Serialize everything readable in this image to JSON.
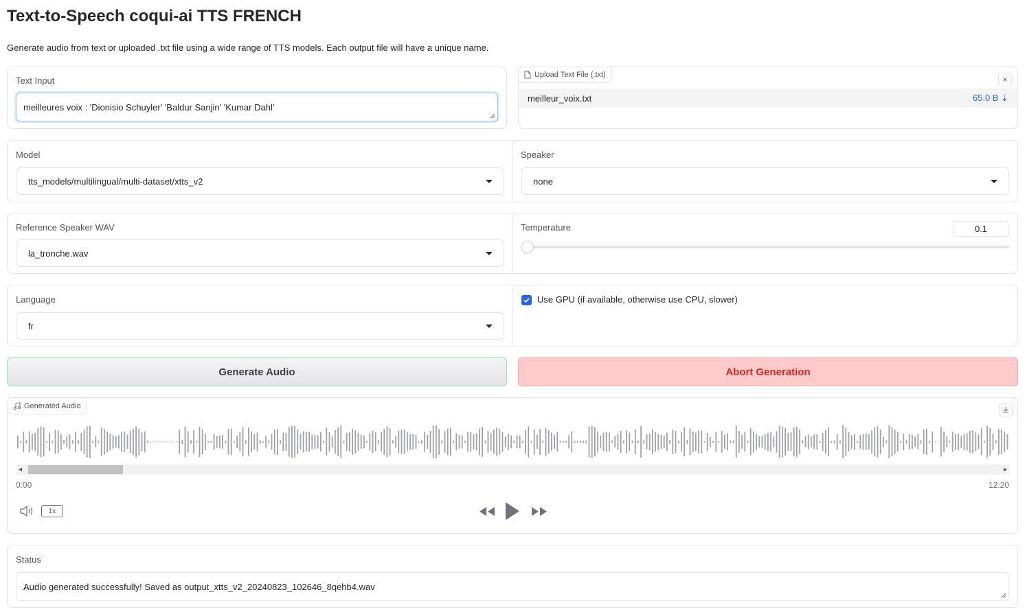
{
  "header": {
    "title": "Text-to-Speech coqui-ai TTS FRENCH",
    "subtitle": "Generate audio from text or uploaded .txt file using a wide range of TTS models. Each output file will have a unique name."
  },
  "text_input": {
    "label": "Text Input",
    "value": "meilleures voix : 'Dionisio Schuyler'  'Baldur Sanjin' 'Kumar Dahl'"
  },
  "upload": {
    "label": "Upload Text File (.txt)",
    "file_name": "meilleur_voix.txt",
    "file_size": "65.0 B",
    "download_glyph": "⇣",
    "close_glyph": "×"
  },
  "model": {
    "label": "Model",
    "selected": "tts_models/multilingual/multi-dataset/xtts_v2"
  },
  "speaker": {
    "label": "Speaker",
    "selected": "none"
  },
  "reference_wav": {
    "label": "Reference Speaker WAV",
    "selected": "la_tronche.wav"
  },
  "temperature": {
    "label": "Temperature",
    "value": "0.1",
    "level": 0.0
  },
  "language": {
    "label": "Language",
    "selected": "fr"
  },
  "gpu": {
    "label": "Use GPU (if available, otherwise use CPU, slower)",
    "checked": true
  },
  "actions": {
    "generate_label": "Generate Audio",
    "abort_label": "Abort Generation"
  },
  "audio": {
    "label": "Generated Audio",
    "current_time": "0:00",
    "duration": "12:20",
    "speed": "1x",
    "scroll_left": "◂",
    "scroll_right": "▸"
  },
  "status": {
    "label": "Status",
    "value": "Audio generated successfully! Saved as output_xtts_v2_20240823_102646_8qehb4.wav"
  },
  "colors": {
    "accent": "#2563eb",
    "abort_bg": "#fecaca",
    "abort_text": "#dc2626",
    "generate_border": "#86efac",
    "waveform": "#a1a1aa"
  }
}
